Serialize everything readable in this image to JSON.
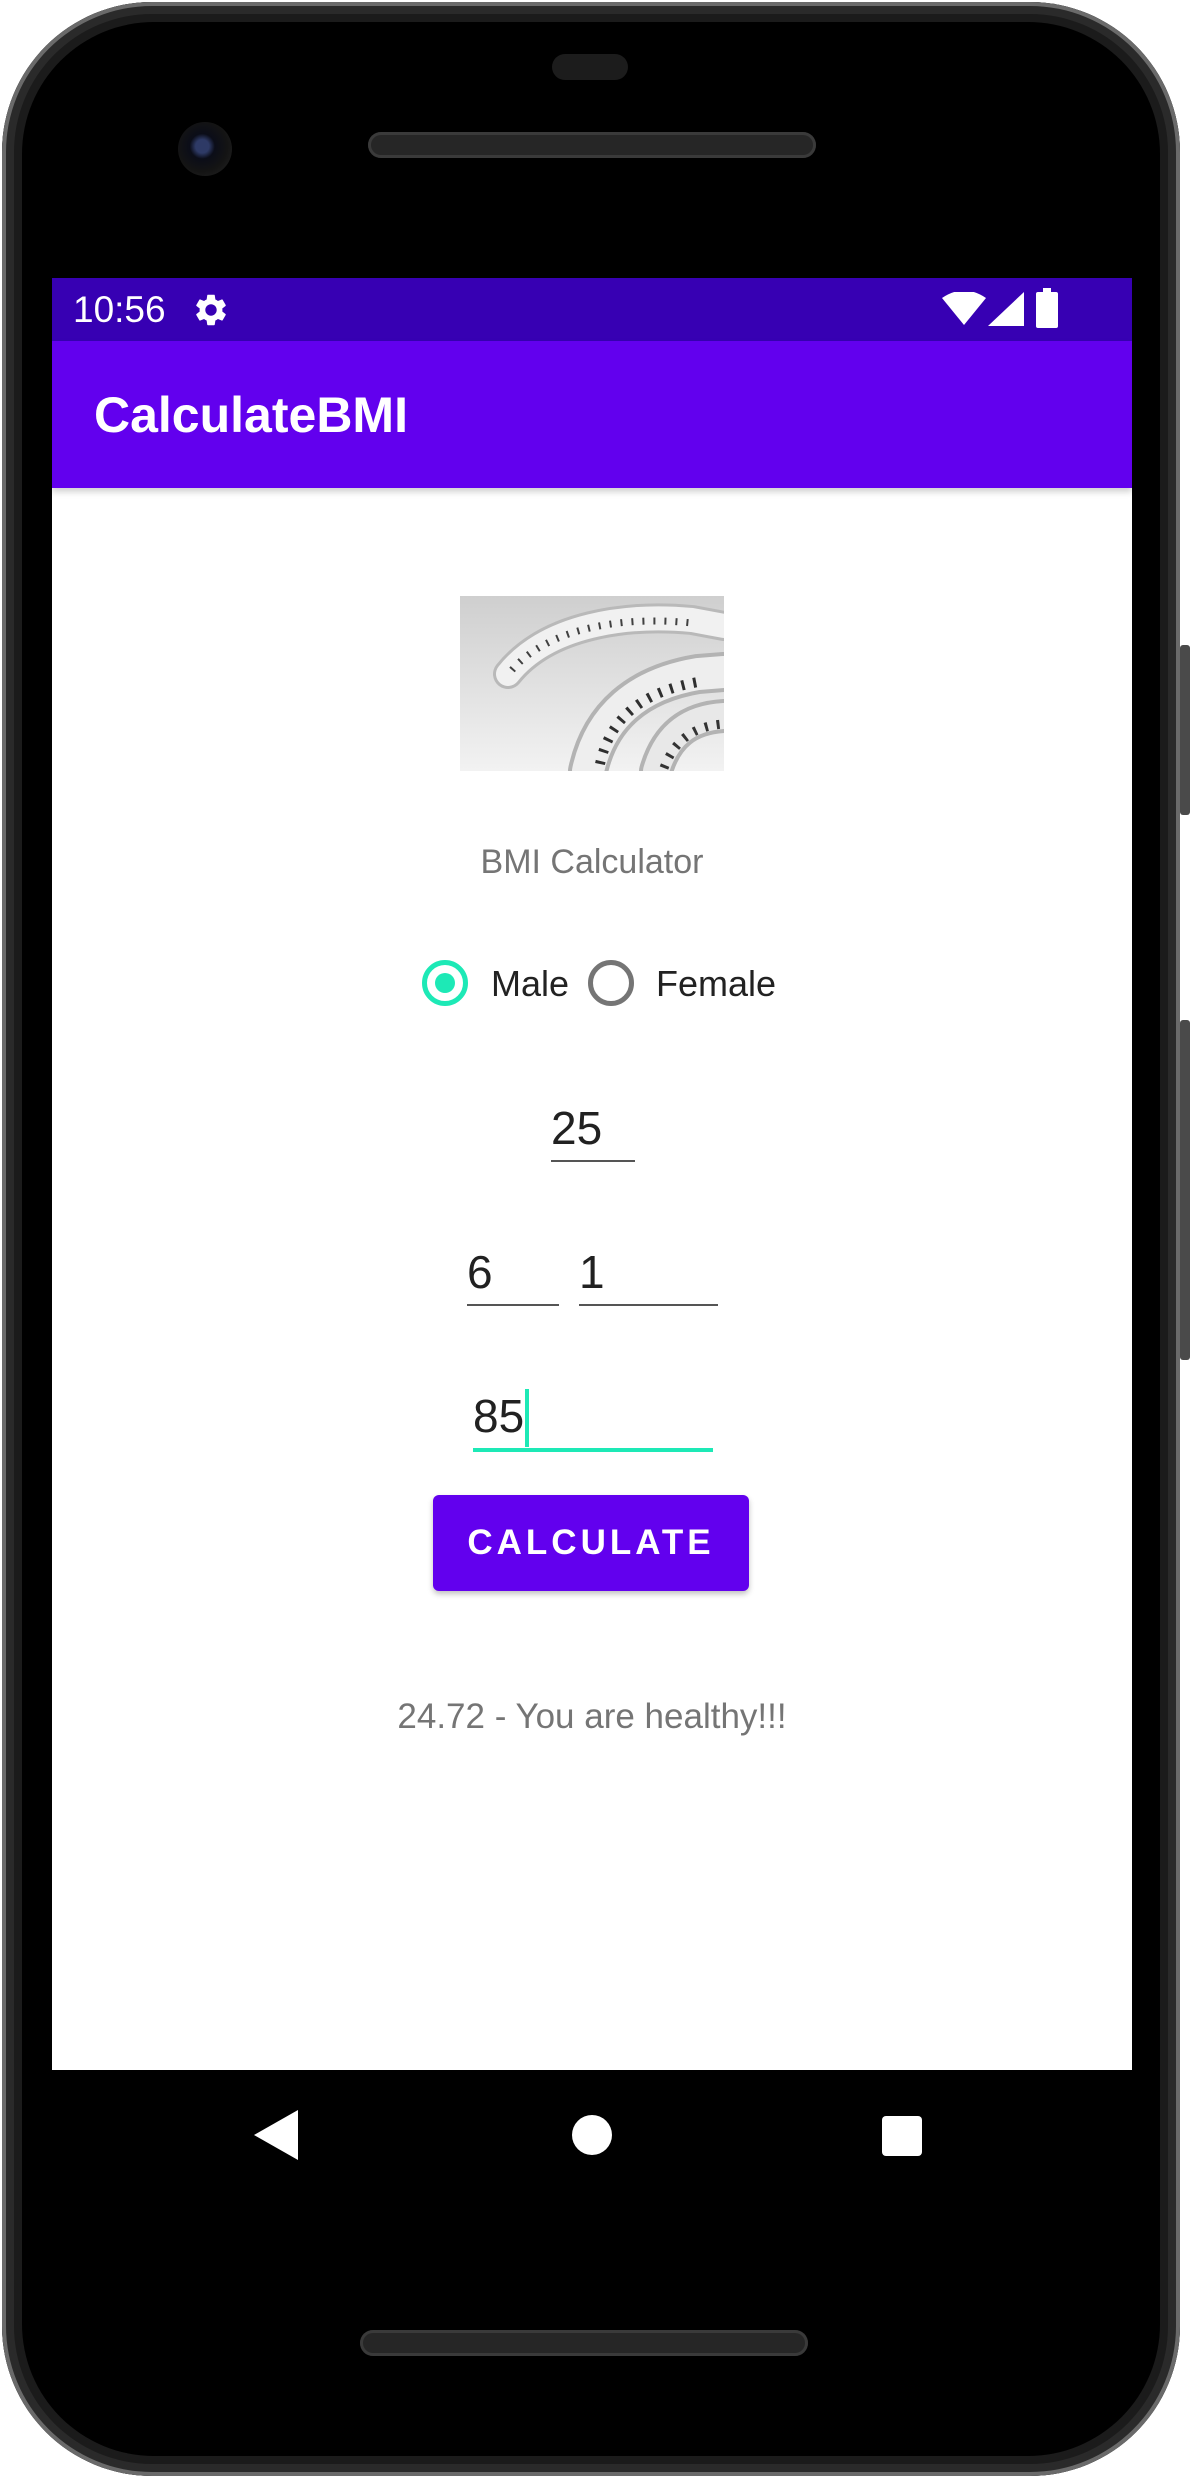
{
  "status_bar": {
    "time": "10:56",
    "icons": [
      "gear-icon",
      "wifi-icon",
      "cell-signal-icon",
      "battery-icon"
    ]
  },
  "app_bar": {
    "title": "CalculateBMI"
  },
  "main": {
    "image": "measuring-tape-image",
    "subtitle": "BMI Calculator",
    "gender": {
      "options": [
        {
          "label": "Male",
          "selected": true
        },
        {
          "label": "Female",
          "selected": false
        }
      ]
    },
    "age_value": "25",
    "height_feet_value": "6",
    "height_inches_value": "1",
    "weight_value": "85",
    "calculate_label": "CALCULATE",
    "result_text": "24.72 - You are healthy!!!"
  },
  "nav_bar": {
    "buttons": [
      "back-icon",
      "home-icon",
      "recents-icon"
    ]
  },
  "colors": {
    "status_bar": "#3700b3",
    "primary": "#6200ee",
    "accent": "#1de9b6",
    "secondary_text": "#757575"
  }
}
